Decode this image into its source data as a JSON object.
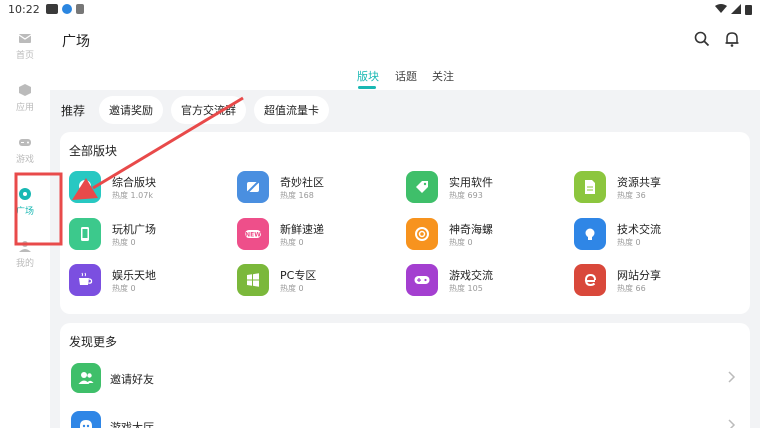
{
  "status_bar": {
    "time": "10:22"
  },
  "nav": {
    "items": [
      {
        "label": "首页",
        "icon": "mail-icon"
      },
      {
        "label": "应用",
        "icon": "cube-icon"
      },
      {
        "label": "游戏",
        "icon": "gamepad-icon"
      },
      {
        "label": "广场",
        "icon": "chat-icon",
        "active": true
      },
      {
        "label": "我的",
        "icon": "person-icon"
      }
    ]
  },
  "header": {
    "title": "广场"
  },
  "tabs": [
    {
      "label": "版块",
      "active": true
    },
    {
      "label": "话题"
    },
    {
      "label": "关注"
    }
  ],
  "recommend": {
    "label": "推荐",
    "chips": [
      "邀请奖励",
      "官方交流群",
      "超值流量卡"
    ]
  },
  "all_boards": {
    "title": "全部版块",
    "boards": [
      {
        "name": "综合版块",
        "heat": "热度 1.07k",
        "color": "#28c8c2",
        "icon": "chat-bubble-icon"
      },
      {
        "name": "奇妙社区",
        "heat": "热度 168",
        "color": "#4a8fe0",
        "icon": "no-ads-icon"
      },
      {
        "name": "实用软件",
        "heat": "热度 693",
        "color": "#3fbf6a",
        "icon": "android-tag-icon"
      },
      {
        "name": "资源共享",
        "heat": "热度 36",
        "color": "#8cc63e",
        "icon": "document-icon"
      },
      {
        "name": "玩机广场",
        "heat": "热度 0",
        "color": "#3cc98c",
        "icon": "phone-icon"
      },
      {
        "name": "新鲜速递",
        "heat": "热度 0",
        "color": "#ee4f8a",
        "icon": "new-badge-icon"
      },
      {
        "name": "神奇海螺",
        "heat": "热度 0",
        "color": "#f7931e",
        "icon": "conch-icon"
      },
      {
        "name": "技术交流",
        "heat": "热度 0",
        "color": "#2f86e6",
        "icon": "lamp-icon"
      },
      {
        "name": "娱乐天地",
        "heat": "热度 0",
        "color": "#7b4fe0",
        "icon": "coffee-icon"
      },
      {
        "name": "PC专区",
        "heat": "热度 0",
        "color": "#7bb83b",
        "icon": "windows-icon"
      },
      {
        "name": "游戏交流",
        "heat": "热度 105",
        "color": "#a43fd0",
        "icon": "gamepad-icon"
      },
      {
        "name": "网站分享",
        "heat": "热度 66",
        "color": "#d9483b",
        "icon": "edge-icon"
      }
    ]
  },
  "discover": {
    "title": "发现更多",
    "items": [
      {
        "label": "邀请好友",
        "color": "#3fbf6a",
        "icon": "users-icon"
      },
      {
        "label": "游戏大厅",
        "color": "#2f86e6",
        "icon": "ghost-icon"
      }
    ]
  },
  "colors": {
    "accent": "#18b8b3",
    "annotation": "#e84a4a"
  }
}
